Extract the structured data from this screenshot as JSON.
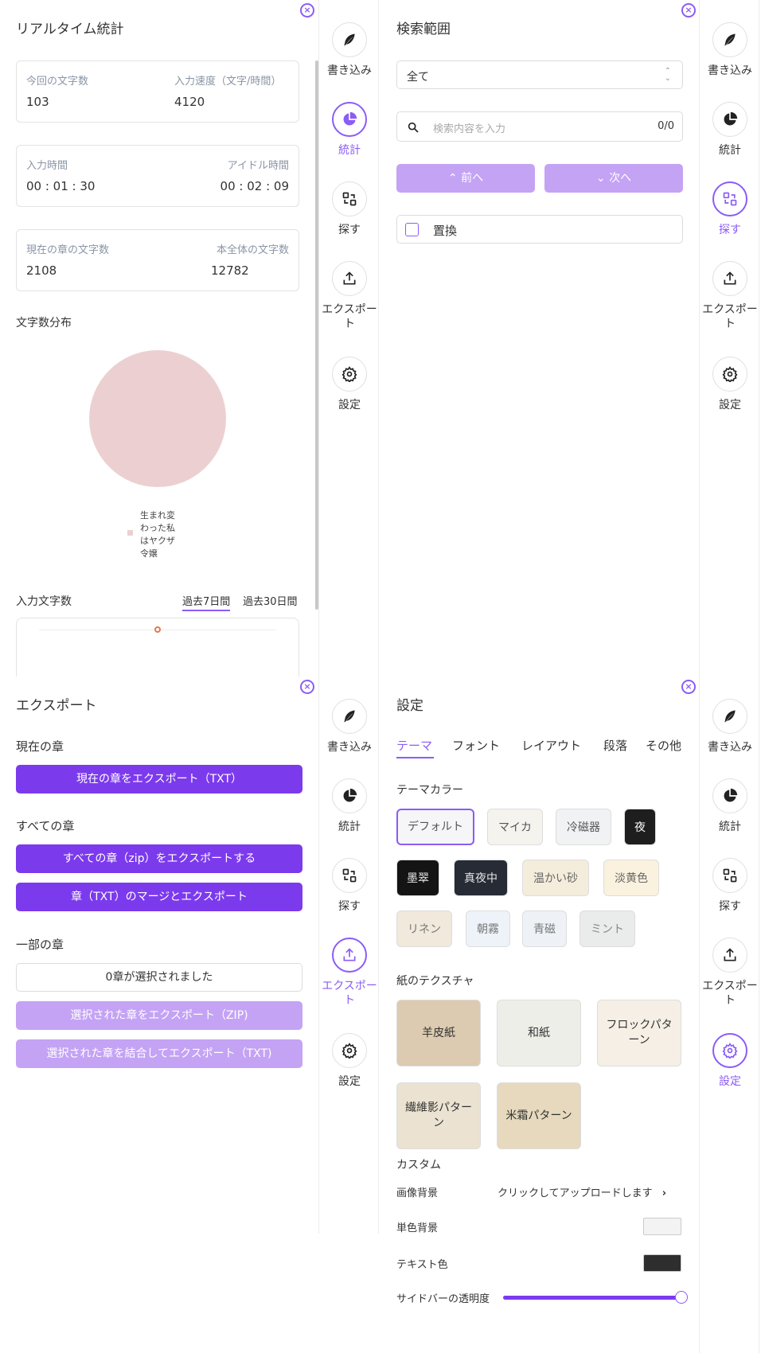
{
  "sidebar": {
    "write": "書き込み",
    "stats": "統計",
    "search": "探す",
    "export": "エクスポート",
    "settings": "設定"
  },
  "stats_panel": {
    "title": "リアルタイム統計",
    "current_chars_label": "今回の文字数",
    "current_chars_value": "103",
    "speed_label": "入力速度（文字/時間）",
    "speed_value": "4120",
    "input_time_label": "入力時間",
    "input_time_value": "00 : 01 : 30",
    "idle_time_label": "アイドル時間",
    "idle_time_value": "00 : 02 : 09",
    "chapter_chars_label": "現在の章の文字数",
    "chapter_chars_value": "2108",
    "book_chars_label": "本全体の文字数",
    "book_chars_value": "12782",
    "distribution_title": "文字数分布",
    "legend": [
      "生まれ変",
      "わった私",
      "はヤクザ",
      "令嬢"
    ],
    "input_chars_title": "入力文字数",
    "tab_7days": "過去7日間",
    "tab_30days": "過去30日間"
  },
  "search_panel": {
    "title": "検索範囲",
    "scope_value": "全て",
    "search_placeholder": "検索内容を入力",
    "search_count": "0/0",
    "prev_label": "前へ",
    "next_label": "次へ",
    "replace_label": "置換"
  },
  "export_panel": {
    "title": "エクスポート",
    "current_chapter_h": "現在の章",
    "export_current_txt": "現在の章をエクスポート（TXT）",
    "all_chapters_h": "すべての章",
    "export_all_zip": "すべての章（zip）をエクスポートする",
    "merge_export_txt": "章（TXT）のマージとエクスポート",
    "partial_h": "一部の章",
    "selected_count": "0章が選択されました",
    "export_selected_zip": "選択された章をエクスポート（ZIP)",
    "merge_selected_txt": "選択された章を結合してエクスポート（TXT)"
  },
  "settings_panel": {
    "title": "設定",
    "tabs": [
      "テーマ",
      "フォント",
      "レイアウト",
      "段落",
      "その他"
    ],
    "theme_color_h": "テーマカラー",
    "themes": [
      "デフォルト",
      "マイカ",
      "冷磁器",
      "夜",
      "墨翠",
      "真夜中",
      "温かい砂",
      "淡黄色",
      "リネン",
      "朝霧",
      "青磁",
      "ミント"
    ],
    "paper_texture_h": "紙のテクスチャ",
    "textures": [
      "羊皮紙",
      "和紙",
      "フロックパターン",
      "繊維影パターン",
      "米霜パターン"
    ],
    "custom_h": "カスタム",
    "image_bg_label": "画像背景",
    "image_bg_action": "クリックしてアップロードします",
    "solid_bg_label": "単色背景",
    "text_color_label": "テキスト色",
    "sidebar_opacity_label": "サイドバーの透明度",
    "sidebar_opacity": 1.0
  },
  "colors": {
    "accent": "#7c3aed",
    "accent_light": "#c4a3f5",
    "pie": "#ecd0d1"
  }
}
